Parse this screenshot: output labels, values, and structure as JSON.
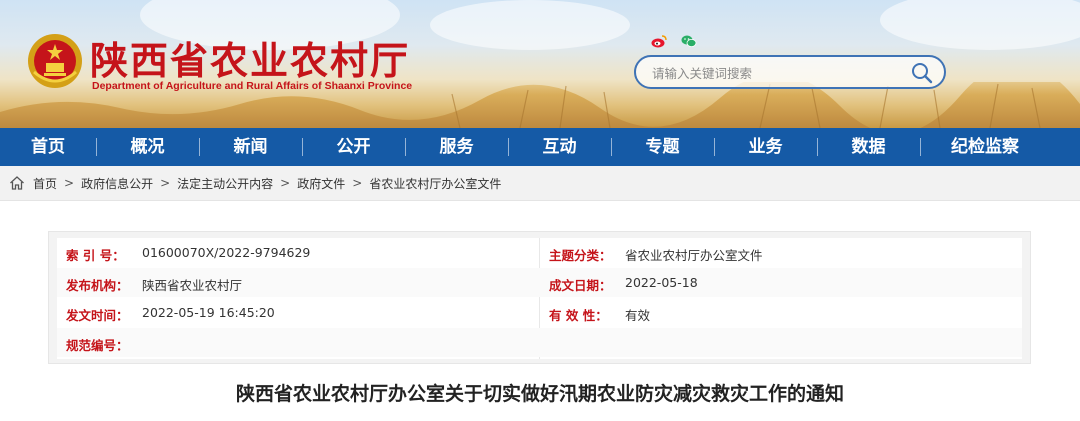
{
  "header": {
    "title_cn": "陕西省农业农村厅",
    "title_en": "Department of Agriculture and Rural Affairs of Shaanxi Province",
    "emblem_icon": "national-emblem-icon",
    "social_icons": [
      "weibo-icon",
      "wechat-icon"
    ],
    "search": {
      "placeholder": "请输入关键词搜索",
      "button_icon": "search-icon"
    }
  },
  "nav": {
    "items": [
      "首页",
      "概况",
      "新闻",
      "公开",
      "服务",
      "互动",
      "专题",
      "业务",
      "数据",
      "纪检监察"
    ]
  },
  "breadcrumb": {
    "home_icon": "home-icon",
    "items": [
      "首页",
      "政府信息公开",
      "法定主动公开内容",
      "政府文件",
      "省农业农村厅办公室文件"
    ],
    "separator": ">"
  },
  "meta": {
    "index_label": "索 引 号：",
    "index_value": "01600070X/2022-9794629",
    "topic_label": "主题分类：",
    "topic_value": "省农业农村厅办公室文件",
    "issuer_label": "发布机构：",
    "issuer_value": "陕西省农业农村厅",
    "date_written_label": "成文日期：",
    "date_written_value": "2022-05-18",
    "publish_time_label": "发文时间：",
    "publish_time_value": "2022-05-19 16:45:20",
    "validity_label": "有 效 性：",
    "validity_value": "有效",
    "spec_number_label": "规范编号："
  },
  "document": {
    "title": "陕西省农业农村厅办公室关于切实做好汛期农业防灾减灾救灾工作的通知"
  },
  "colors": {
    "brand_red": "#c5141a",
    "nav_blue": "#155aa6",
    "search_border": "#3f73b5"
  }
}
